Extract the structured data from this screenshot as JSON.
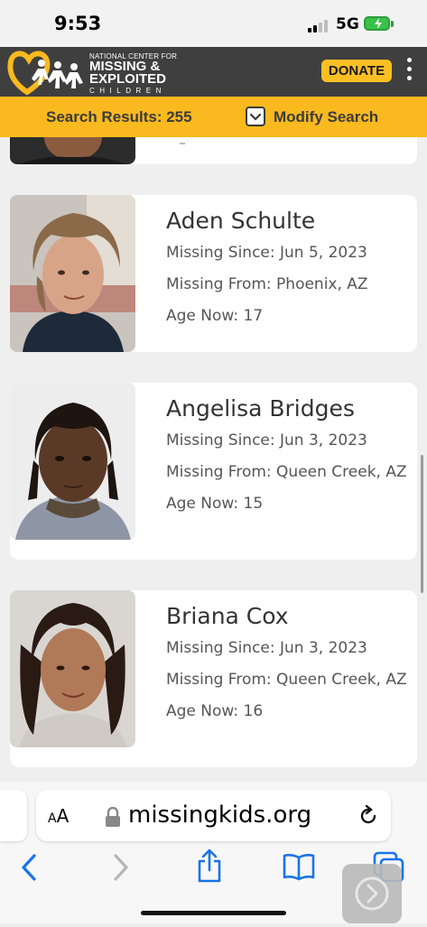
{
  "status_bar": {
    "time": "9:53",
    "network": "5G"
  },
  "header": {
    "org_line1": "NATIONAL CENTER FOR",
    "org_line2": "MISSING &",
    "org_line3": "EXPLOITED",
    "org_line4": "CHILDREN",
    "donate_label": "DONATE",
    "menu_icon": "more-vertical-icon"
  },
  "search": {
    "results_label": "Search Results: 255",
    "modify_label": "Modify Search",
    "modify_icon": "chevron-down-icon"
  },
  "cards": [
    {
      "name": "Aden Schulte",
      "missing_since": "Missing Since: Jun 5, 2023",
      "missing_from": "Missing From: Phoenix, AZ",
      "age_now": "Age Now: 17"
    },
    {
      "name": "Angelisa Bridges",
      "missing_since": "Missing Since: Jun 3, 2023",
      "missing_from": "Missing From: Queen Creek, AZ",
      "age_now": "Age Now: 15"
    },
    {
      "name": "Briana Cox",
      "missing_since": "Missing Since: Jun 3, 2023",
      "missing_from": "Missing From: Queen Creek, AZ",
      "age_now": "Age Now: 16"
    }
  ],
  "browser": {
    "text_size_label_big": "A",
    "text_size_label_small": "A",
    "url": "missingkids.org",
    "icons": [
      "chevron-left-icon",
      "chevron-right-icon",
      "share-icon",
      "bookmarks-icon",
      "tabs-icon",
      "lock-icon",
      "reload-icon"
    ]
  },
  "colors": {
    "header_bg": "#3f3f3f",
    "accent": "#f9b91f",
    "link_blue": "#1a73e8"
  }
}
